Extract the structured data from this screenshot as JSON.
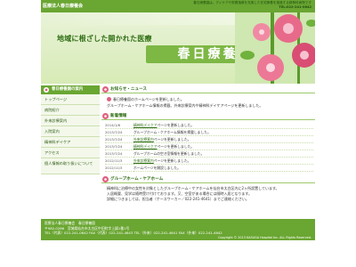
{
  "header": {
    "org_name": "医療法人春日療養会",
    "info_line1": "春日療養園は、ディケアや栄養指導を充実した在宅療養を推進する精神科病院です",
    "info_line2": "TEL:022-241-0642"
  },
  "banner": {
    "tagline": "地域に根ざした開かれた医療",
    "title": "春日療養園"
  },
  "sidebar": {
    "heading": "春日療養園の案内",
    "items": [
      {
        "label": "トップページ"
      },
      {
        "label": "病院紹介"
      },
      {
        "label": "外来診療案内"
      },
      {
        "label": "入院案内"
      },
      {
        "label": "精神科デイケア"
      },
      {
        "label": "アクセス"
      },
      {
        "label": "個人情報の取り扱いについて"
      }
    ]
  },
  "news": {
    "heading": "お知らせ・ニュース",
    "line1": "春日療養園のホームページを更新しました。",
    "line2": "グループホーム・ケアホーム情報の掲載、外来診療案内や精神科デイケアページを更新しました。"
  },
  "updates": {
    "heading": "新着情報",
    "rows": [
      {
        "date": "2014/1/6",
        "link": "精神科デイケア",
        "rest": "ページを更新しました。"
      },
      {
        "date": "2013/7/24",
        "link": "",
        "rest": "グループホーム・ケアホーム情報を掲載しました。"
      },
      {
        "date": "2013/7/24",
        "link": "外来診療案内",
        "rest": "ページを更新しました。"
      },
      {
        "date": "2013/7/24",
        "link": "精神科デイケア",
        "rest": "ページを更新しました。"
      },
      {
        "date": "2013/7/24",
        "link": "",
        "rest": "グループホームの空き室情報を更新しました。"
      },
      {
        "date": "2012/11/3",
        "link": "外来診療案内",
        "rest": "ページを更新しました。"
      },
      {
        "date": "2012/11/3",
        "link": "",
        "rest": "ホームページを開設しました。"
      }
    ]
  },
  "group": {
    "heading": "グループホーム・ケアホーム",
    "line1": "精神科に治療中の女性を対象としたグループホーム・ケアホームを仙台市太白区内に2ヶ所設置しています。",
    "line2": "入居概要、見学は随時受け付けております。又、空室がある場合には随時入居となります。",
    "line3": "詳細につきましては、担当者（ケースワーカー／022-241-4641）までご連絡ください。"
  },
  "footer": {
    "line1": "医療法人春日療養会　春日療養園",
    "line2": "〒982-0266　宮城県仙台市太白区中田町字上鍋1番1号",
    "line3": "TEL（代表）022-241-0642 FAX（代表）022-241-4643 TEL（外来）022-241-4641 FAX（外来）022-241-4642",
    "copyright": "Copyright © 2013 KASUGA Hospital Inc. ALL Rights Reserved."
  },
  "colors": {
    "accent": "#6aa632",
    "accent_dark": "#2f6e14",
    "flower": "#e0607e"
  }
}
